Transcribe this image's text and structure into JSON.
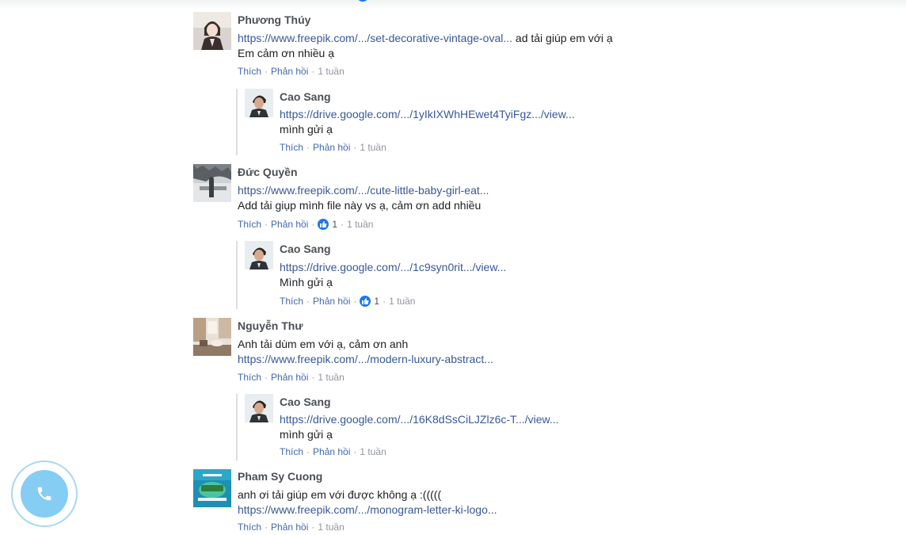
{
  "labels": {
    "like": "Thích",
    "reply": "Phản hồi",
    "separator": "·"
  },
  "comments": [
    {
      "author": "Phương Thúy",
      "lines": [
        {
          "link": "https://www.freepik.com/.../set-decorative-vintage-oval...",
          "text": " ad tải giúp em với ạ"
        },
        {
          "text": "Em cảm ơn nhiều ạ"
        }
      ],
      "time": "1 tuần",
      "reply": {
        "author": "Cao Sang",
        "lines": [
          {
            "link": "https://drive.google.com/.../1yIkIXWhHEwet4TyiFgz.../view..."
          },
          {
            "text": "mình gửi ạ"
          }
        ],
        "time": "1 tuần"
      }
    },
    {
      "author": "Đức Quyền",
      "lines": [
        {
          "link": "https://www.freepik.com/.../cute-little-baby-girl-eat..."
        },
        {
          "text": "Add tải giụp mình file này vs ạ, cảm ơn add nhiều"
        }
      ],
      "likes": "1",
      "time": "1 tuần",
      "reply": {
        "author": "Cao Sang",
        "lines": [
          {
            "link": "https://drive.google.com/.../1c9syn0rit.../view..."
          },
          {
            "text": "Mình gửi ạ"
          }
        ],
        "likes": "1",
        "time": "1 tuần"
      }
    },
    {
      "author": "Nguyễn Thư",
      "lines": [
        {
          "text": "Anh tải dùm em với ạ, cảm ơn anh"
        },
        {
          "link": "https://www.freepik.com/.../modern-luxury-abstract..."
        }
      ],
      "time": "1 tuần",
      "reply": {
        "author": "Cao Sang",
        "lines": [
          {
            "link": "https://drive.google.com/.../16K8dSsCiLJZlz6c-T.../view..."
          },
          {
            "text": "mình gửi ạ"
          }
        ],
        "time": "1 tuần"
      }
    },
    {
      "author": "Pham Sy Cuong",
      "lines": [
        {
          "text": "anh ơi tải giúp em với được không ạ :((((("
        },
        {
          "link": "https://www.freepik.com/.../monogram-letter-ki-logo..."
        }
      ],
      "time": "1 tuần"
    }
  ],
  "icons": {
    "call": "phone-icon",
    "like": "thumbs-up-icon"
  },
  "colors": {
    "link": "#385898",
    "name": "#4b4f56",
    "action": "#4267b2",
    "meta": "#90949c",
    "call_button": "#86cdf3"
  }
}
